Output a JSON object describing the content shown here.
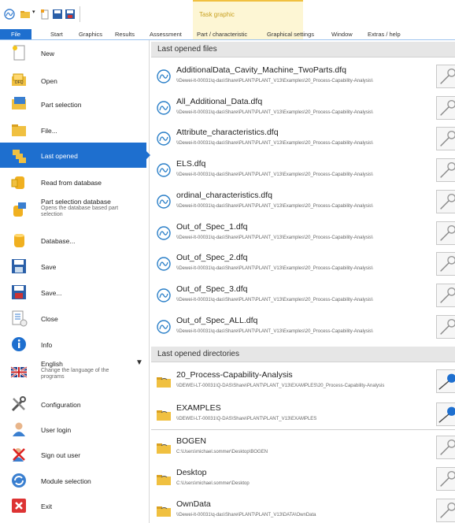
{
  "ribbon": {
    "context_tab": "Task graphic",
    "tabs": [
      "File",
      "Start",
      "Graphics",
      "Results",
      "Assessment",
      "Part / characteristic",
      "Graphical settings",
      "Window",
      "Extras / help"
    ]
  },
  "menu": {
    "items": [
      {
        "label": "New",
        "icon": "new-document-icon"
      },
      {
        "label": "Open",
        "icon": "open-dfq-icon"
      },
      {
        "label": "Part selection",
        "icon": "part-selection-icon"
      },
      {
        "label": "File...",
        "icon": "folder-icon"
      },
      {
        "label": "Last opened",
        "icon": "last-opened-icon"
      },
      {
        "label": "Read from database",
        "icon": "database-read-icon"
      },
      {
        "label": "Part selection database",
        "sub": "Opens the database based part selection",
        "icon": "database-part-icon"
      },
      {
        "label": "Database...",
        "icon": "database-icon"
      },
      {
        "label": "Save",
        "icon": "save-icon"
      },
      {
        "label": "Save...",
        "icon": "save-as-icon"
      },
      {
        "label": "Close",
        "icon": "close-document-icon"
      },
      {
        "label": "Info",
        "icon": "info-icon"
      },
      {
        "label": "English",
        "sub": "Change the language of the programs",
        "icon": "uk-flag-icon"
      },
      {
        "label": "Configuration",
        "icon": "tools-icon"
      },
      {
        "label": "User login",
        "icon": "user-icon"
      },
      {
        "label": "Sign out user",
        "icon": "sign-out-icon"
      },
      {
        "label": "Module selection",
        "icon": "module-selection-icon"
      },
      {
        "label": "Exit",
        "icon": "exit-icon"
      }
    ]
  },
  "files_header": "Last opened files",
  "files": [
    {
      "name": "AdditionalData_Cavity_Machine_TwoParts.dfq",
      "path": "\\\\Dewei-lt-00031\\q-das\\Share\\PLANT\\PLANT_V13\\Examples\\20_Process-Capability-Analysis\\"
    },
    {
      "name": "All_Additional_Data.dfq",
      "path": "\\\\Dewei-lt-00031\\q-das\\Share\\PLANT\\PLANT_V13\\Examples\\20_Process-Capability-Analysis\\"
    },
    {
      "name": "Attribute_characteristics.dfq",
      "path": "\\\\Dewei-lt-00031\\q-das\\Share\\PLANT\\PLANT_V13\\Examples\\20_Process-Capability-Analysis\\"
    },
    {
      "name": "ELS.dfq",
      "path": "\\\\Dewei-lt-00031\\q-das\\Share\\PLANT\\PLANT_V13\\Examples\\20_Process-Capability-Analysis\\"
    },
    {
      "name": "ordinal_characteristics.dfq",
      "path": "\\\\Dewei-lt-00031\\q-das\\Share\\PLANT\\PLANT_V13\\Examples\\20_Process-Capability-Analysis\\"
    },
    {
      "name": "Out_of_Spec_1.dfq",
      "path": "\\\\Dewei-lt-00031\\q-das\\Share\\PLANT\\PLANT_V13\\Examples\\20_Process-Capability-Analysis\\"
    },
    {
      "name": "Out_of_Spec_2.dfq",
      "path": "\\\\Dewei-lt-00031\\q-das\\Share\\PLANT\\PLANT_V13\\Examples\\20_Process-Capability-Analysis\\"
    },
    {
      "name": "Out_of_Spec_3.dfq",
      "path": "\\\\Dewei-lt-00031\\q-das\\Share\\PLANT\\PLANT_V13\\Examples\\20_Process-Capability-Analysis\\"
    },
    {
      "name": "Out_of_Spec_ALL.dfq",
      "path": "\\\\Dewei-lt-00031\\q-das\\Share\\PLANT\\PLANT_V13\\Examples\\20_Process-Capability-Analysis\\"
    }
  ],
  "dirs_header": "Last opened directories",
  "dirs": [
    {
      "name": "20_Process-Capability-Analysis",
      "path": "\\\\DEWEI-LT-00031\\Q-DAS\\Share\\PLANT\\PLANT_V13\\EXAMPLES\\20_Process-Capability-Analysis",
      "pinned": true
    },
    {
      "name": "EXAMPLES",
      "path": "\\\\DEWEI-LT-00031\\Q-DAS\\Share\\PLANT\\PLANT_V13\\EXAMPLES",
      "pinned": true
    },
    {
      "name": "BOGEN",
      "path": "C:\\Users\\michael.sommer\\Desktop\\BOGEN",
      "pinned": false
    },
    {
      "name": "Desktop",
      "path": "C:\\Users\\michael.sommer\\Desktop",
      "pinned": false
    },
    {
      "name": "OwnData",
      "path": "\\\\Dewei-lt-00031\\q-das\\Share\\PLANT\\PLANT_V13\\DATA\\OwnData",
      "pinned": false
    }
  ],
  "colors": {
    "accent": "#1e6fcf",
    "section_bg": "#e6e6e6",
    "context_tab": "#fdf6d4"
  }
}
